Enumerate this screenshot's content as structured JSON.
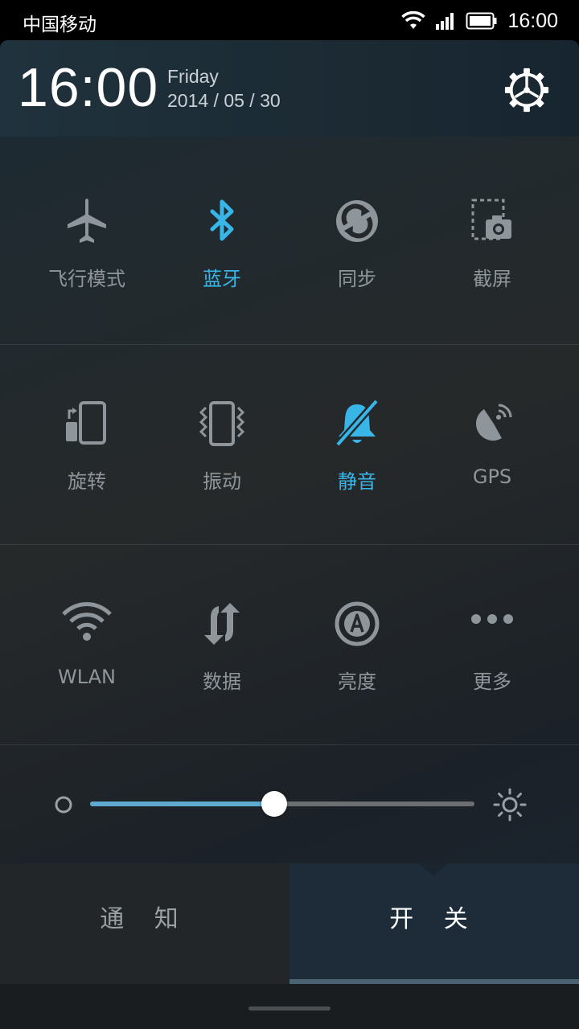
{
  "status_bar": {
    "carrier": "中国移动",
    "time": "16:00"
  },
  "header": {
    "time": "16:00",
    "weekday": "Friday",
    "date": "2014 / 05 / 30"
  },
  "toggles": [
    {
      "label": "飞行模式",
      "icon": "airplane-icon",
      "active": false
    },
    {
      "label": "蓝牙",
      "icon": "bluetooth-icon",
      "active": true
    },
    {
      "label": "同步",
      "icon": "sync-icon",
      "active": false
    },
    {
      "label": "截屏",
      "icon": "screenshot-icon",
      "active": false
    },
    {
      "label": "旋转",
      "icon": "rotate-icon",
      "active": false
    },
    {
      "label": "振动",
      "icon": "vibrate-icon",
      "active": false
    },
    {
      "label": "静音",
      "icon": "mute-icon",
      "active": true
    },
    {
      "label": "GPS",
      "icon": "gps-icon",
      "active": false
    },
    {
      "label": "WLAN",
      "icon": "wifi-icon",
      "active": false
    },
    {
      "label": "数据",
      "icon": "mobile-data-icon",
      "active": false
    },
    {
      "label": "亮度",
      "icon": "auto-brightness-icon",
      "active": false
    },
    {
      "label": "更多",
      "icon": "more-icon",
      "active": false
    }
  ],
  "brightness": {
    "level": 0.48
  },
  "tabs": {
    "notifications": "通 知",
    "switches": "开 关",
    "selected": "switches"
  },
  "colors": {
    "active": "#38b6e8",
    "inactive": "#8e969b"
  }
}
